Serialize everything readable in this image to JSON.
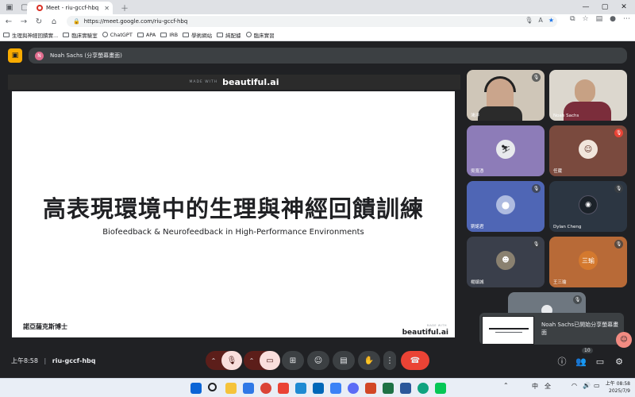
{
  "browser": {
    "tab_title": "Meet - riu-gccf-hbq",
    "url": "https://meet.google.com/riu-gccf-hbq",
    "bookmarks": [
      "生理與神經回饋實...",
      "臨床實驗室",
      "ChatGPT",
      "APA",
      "IRB",
      "學術網站",
      "純配據",
      "臨床實習"
    ]
  },
  "meet": {
    "presenting_banner": "Noah Sachs (分享螢幕畫面)",
    "presenter_initial": "N",
    "slide": {
      "made_with": "MADE WITH",
      "brand": "beautiful.ai",
      "title": "高表現環境中的生理與神經回饋訓練",
      "subtitle": "Biofeedback & Neurofeedback in High-Performance Environments",
      "author": "諾亞薩克斯博士",
      "footer_made_with": "MADE WITH",
      "footer_brand": "beautiful.ai"
    },
    "participants": [
      {
        "name": "鴻洋",
        "mic": "muted"
      },
      {
        "name": "Noah Sachs",
        "mic": "on"
      },
      {
        "name": "吳寬憑",
        "mic": "on"
      },
      {
        "name": "任葳",
        "mic": "muted"
      },
      {
        "name": "劉諾君",
        "mic": "muted"
      },
      {
        "name": "Dylan Cheng",
        "mic": "muted"
      },
      {
        "name": "楊鎮城",
        "mic": "muted"
      },
      {
        "name": "王三瑜",
        "mic": "muted",
        "initials": "三瑜"
      },
      {
        "name": "",
        "mic": "muted"
      }
    ],
    "notification": "Noah Sachs已開始分享螢幕畫面",
    "meeting_time": "上午8:58",
    "meeting_code": "riu-gccf-hbq",
    "participant_count": "10"
  },
  "taskbar": {
    "time": "上午 08:58",
    "date": "2025/7/9",
    "input_method": "中",
    "tray_indicator": "全"
  },
  "colors": {
    "meet_bg": "#202124",
    "presenter_accent": "#f9ab00",
    "end_call": "#ea4335",
    "muted_control": "#f9dedc"
  }
}
